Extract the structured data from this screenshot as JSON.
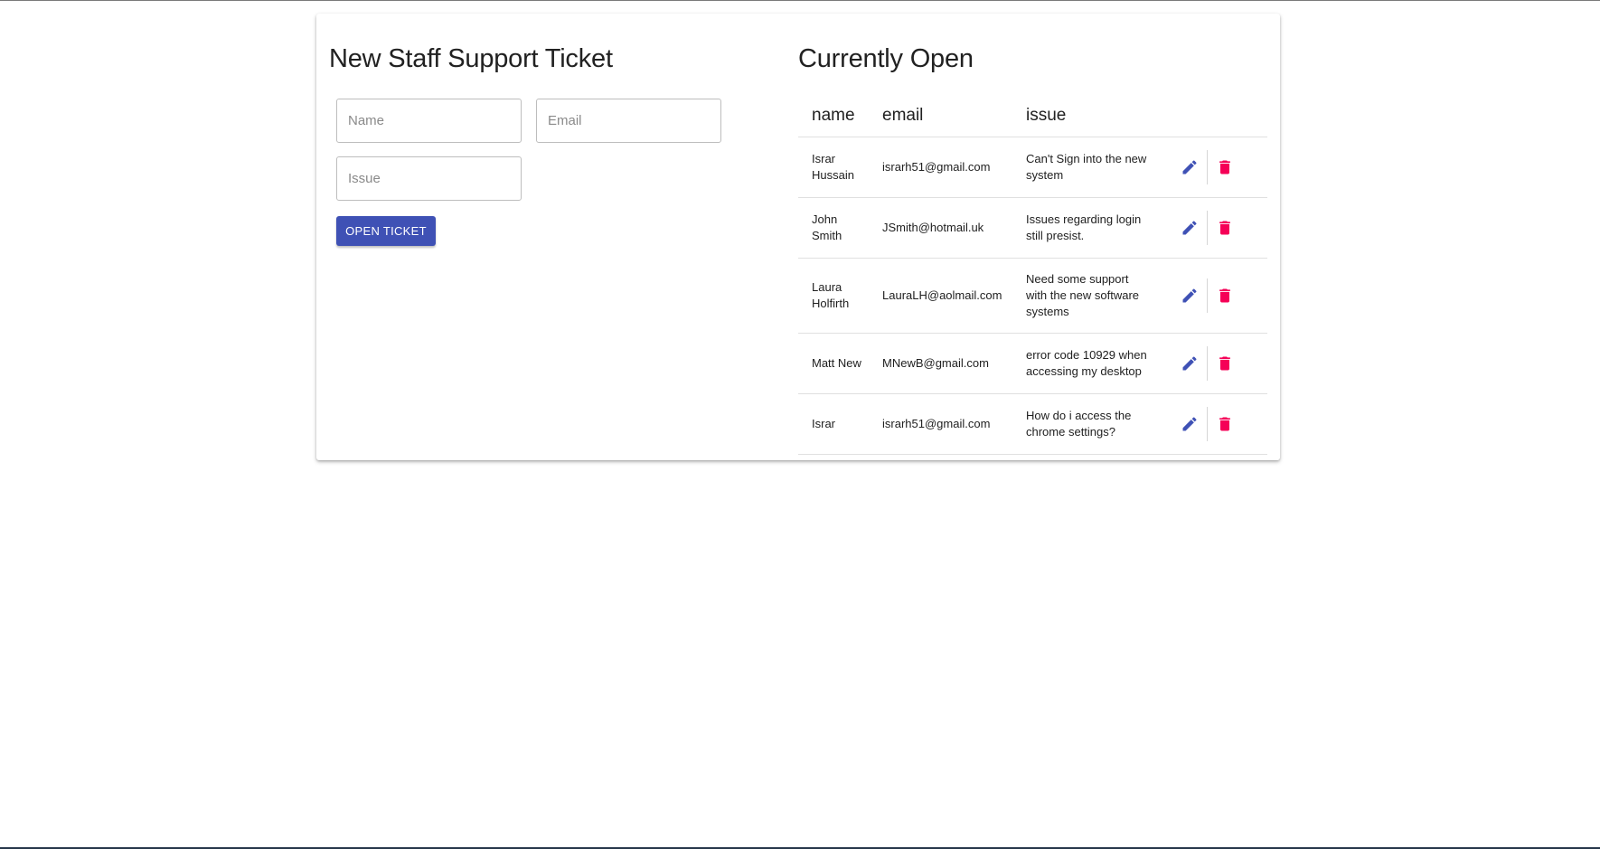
{
  "form": {
    "title": "New Staff Support Ticket",
    "name_placeholder": "Name",
    "email_placeholder": "Email",
    "issue_placeholder": "Issue",
    "name_value": "",
    "email_value": "",
    "issue_value": "",
    "submit_label": "OPEN TICKET"
  },
  "tickets": {
    "title": "Currently Open",
    "columns": {
      "name": "name",
      "email": "email",
      "issue": "issue"
    },
    "rows": [
      {
        "name": "Israr Hussain",
        "email": "israrh51@gmail.com",
        "issue": "Can't Sign into the new system"
      },
      {
        "name": "John Smith",
        "email": "JSmith@hotmail.uk",
        "issue": "Issues regarding login still presist."
      },
      {
        "name": "Laura Holfirth",
        "email": "LauraLH@aolmail.com",
        "issue": "Need some support with the new software systems"
      },
      {
        "name": "Matt New",
        "email": "MNewB@gmail.com",
        "issue": "error code 10929 when accessing my desktop"
      },
      {
        "name": "Israr",
        "email": "israrh51@gmail.com",
        "issue": "How do i access the chrome settings?"
      }
    ],
    "row_actions": {
      "edit_icon": "pencil-icon",
      "delete_icon": "trash-icon"
    }
  },
  "colors": {
    "primary": "#3f51b5",
    "delete": "#f50057",
    "text": "#212121"
  }
}
